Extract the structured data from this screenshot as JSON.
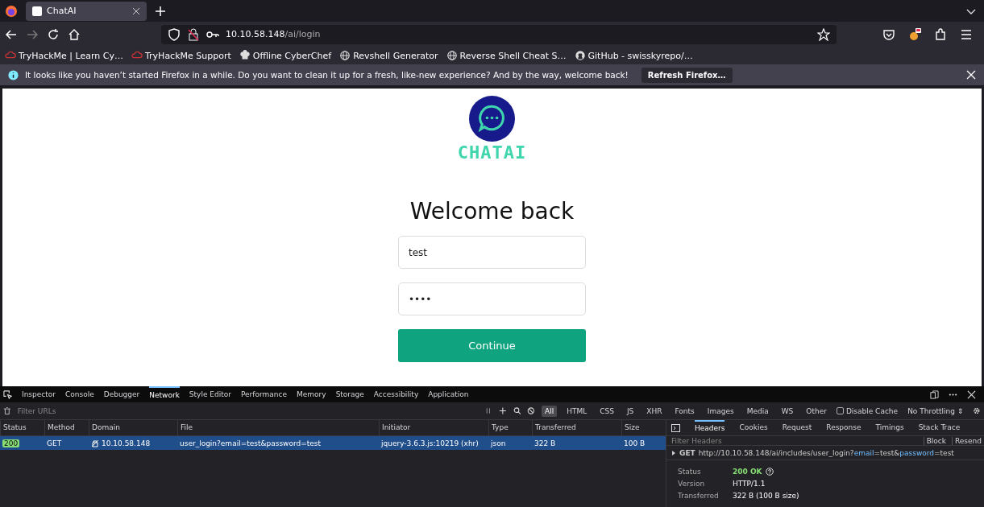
{
  "browser": {
    "tabs": [
      {
        "title": "ChatAI",
        "selected": true
      }
    ],
    "url": {
      "host": "10.10.58.148",
      "path": "/ai/login"
    },
    "bookmarks": [
      {
        "label": "TryHackMe | Learn Cy…",
        "kind": "cloud"
      },
      {
        "label": "TryHackMe Support",
        "kind": "cloud"
      },
      {
        "label": "Offline CyberChef",
        "kind": "chef"
      },
      {
        "label": "Revshell Generator",
        "kind": "globe"
      },
      {
        "label": "Reverse Shell Cheat S…",
        "kind": "globe"
      },
      {
        "label": "GitHub - swisskyrepo/…",
        "kind": "github"
      }
    ],
    "notification": {
      "message": "It looks like you haven’t started Firefox in a while. Do you want to clean it up for a fresh, like-new experience? And by the way, welcome back!",
      "button": "Refresh Firefox…"
    }
  },
  "page": {
    "brand": "CHATAI",
    "heading": "Welcome back",
    "email_value": "test",
    "password_value": "••••",
    "button": "Continue"
  },
  "devtools": {
    "tools": [
      {
        "label": "Inspector",
        "selected": false
      },
      {
        "label": "Console",
        "selected": false
      },
      {
        "label": "Debugger",
        "selected": false
      },
      {
        "label": "Network",
        "selected": true
      },
      {
        "label": "Style Editor",
        "selected": false
      },
      {
        "label": "Performance",
        "selected": false
      },
      {
        "label": "Memory",
        "selected": false
      },
      {
        "label": "Storage",
        "selected": false
      },
      {
        "label": "Accessibility",
        "selected": false
      },
      {
        "label": "Application",
        "selected": false
      }
    ],
    "filter_placeholder": "Filter URLs",
    "type_filters": [
      {
        "label": "All",
        "selected": true
      },
      {
        "label": "HTML",
        "selected": false
      },
      {
        "label": "CSS",
        "selected": false
      },
      {
        "label": "JS",
        "selected": false
      },
      {
        "label": "XHR",
        "selected": false
      },
      {
        "label": "Fonts",
        "selected": false
      },
      {
        "label": "Images",
        "selected": false
      },
      {
        "label": "Media",
        "selected": false
      },
      {
        "label": "WS",
        "selected": false
      },
      {
        "label": "Other",
        "selected": false
      }
    ],
    "disable_cache": {
      "label": "Disable Cache",
      "checked": false
    },
    "throttling": "No Throttling ⇕",
    "columns": [
      "Status",
      "Method",
      "Domain",
      "File",
      "Initiator",
      "Type",
      "Transferred",
      "Size"
    ],
    "rows": [
      {
        "status": "200",
        "method": "GET",
        "domain": "10.10.58.148",
        "file": "user_login?email=test&password=test",
        "initiator": "jquery-3.6.3.js:10219 (xhr)",
        "type": "json",
        "transferred": "322 B",
        "size": "100 B",
        "selected": true
      }
    ],
    "detail": {
      "tabs": [
        {
          "label": "Headers",
          "selected": true
        },
        {
          "label": "Cookies",
          "selected": false
        },
        {
          "label": "Request",
          "selected": false
        },
        {
          "label": "Response",
          "selected": false
        },
        {
          "label": "Timings",
          "selected": false
        },
        {
          "label": "Stack Trace",
          "selected": false
        }
      ],
      "filter_placeholder": "Filter Headers",
      "block": "Block",
      "resend": "Resend",
      "method": "GET",
      "url_parts": [
        {
          "text": "http://10.10.58.148/ai/includes/user_login?",
          "kind": "plain"
        },
        {
          "text": "email",
          "kind": "key"
        },
        {
          "text": "=test&",
          "kind": "plain"
        },
        {
          "text": "password",
          "kind": "key"
        },
        {
          "text": "=test",
          "kind": "plain"
        }
      ],
      "fields": [
        {
          "label": "Status",
          "value": "200 OK",
          "kind": "status"
        },
        {
          "label": "Version",
          "value": "HTTP/1.1",
          "kind": "plain"
        },
        {
          "label": "Transferred",
          "value": "322 B (100 B size)",
          "kind": "plain"
        }
      ]
    }
  }
}
